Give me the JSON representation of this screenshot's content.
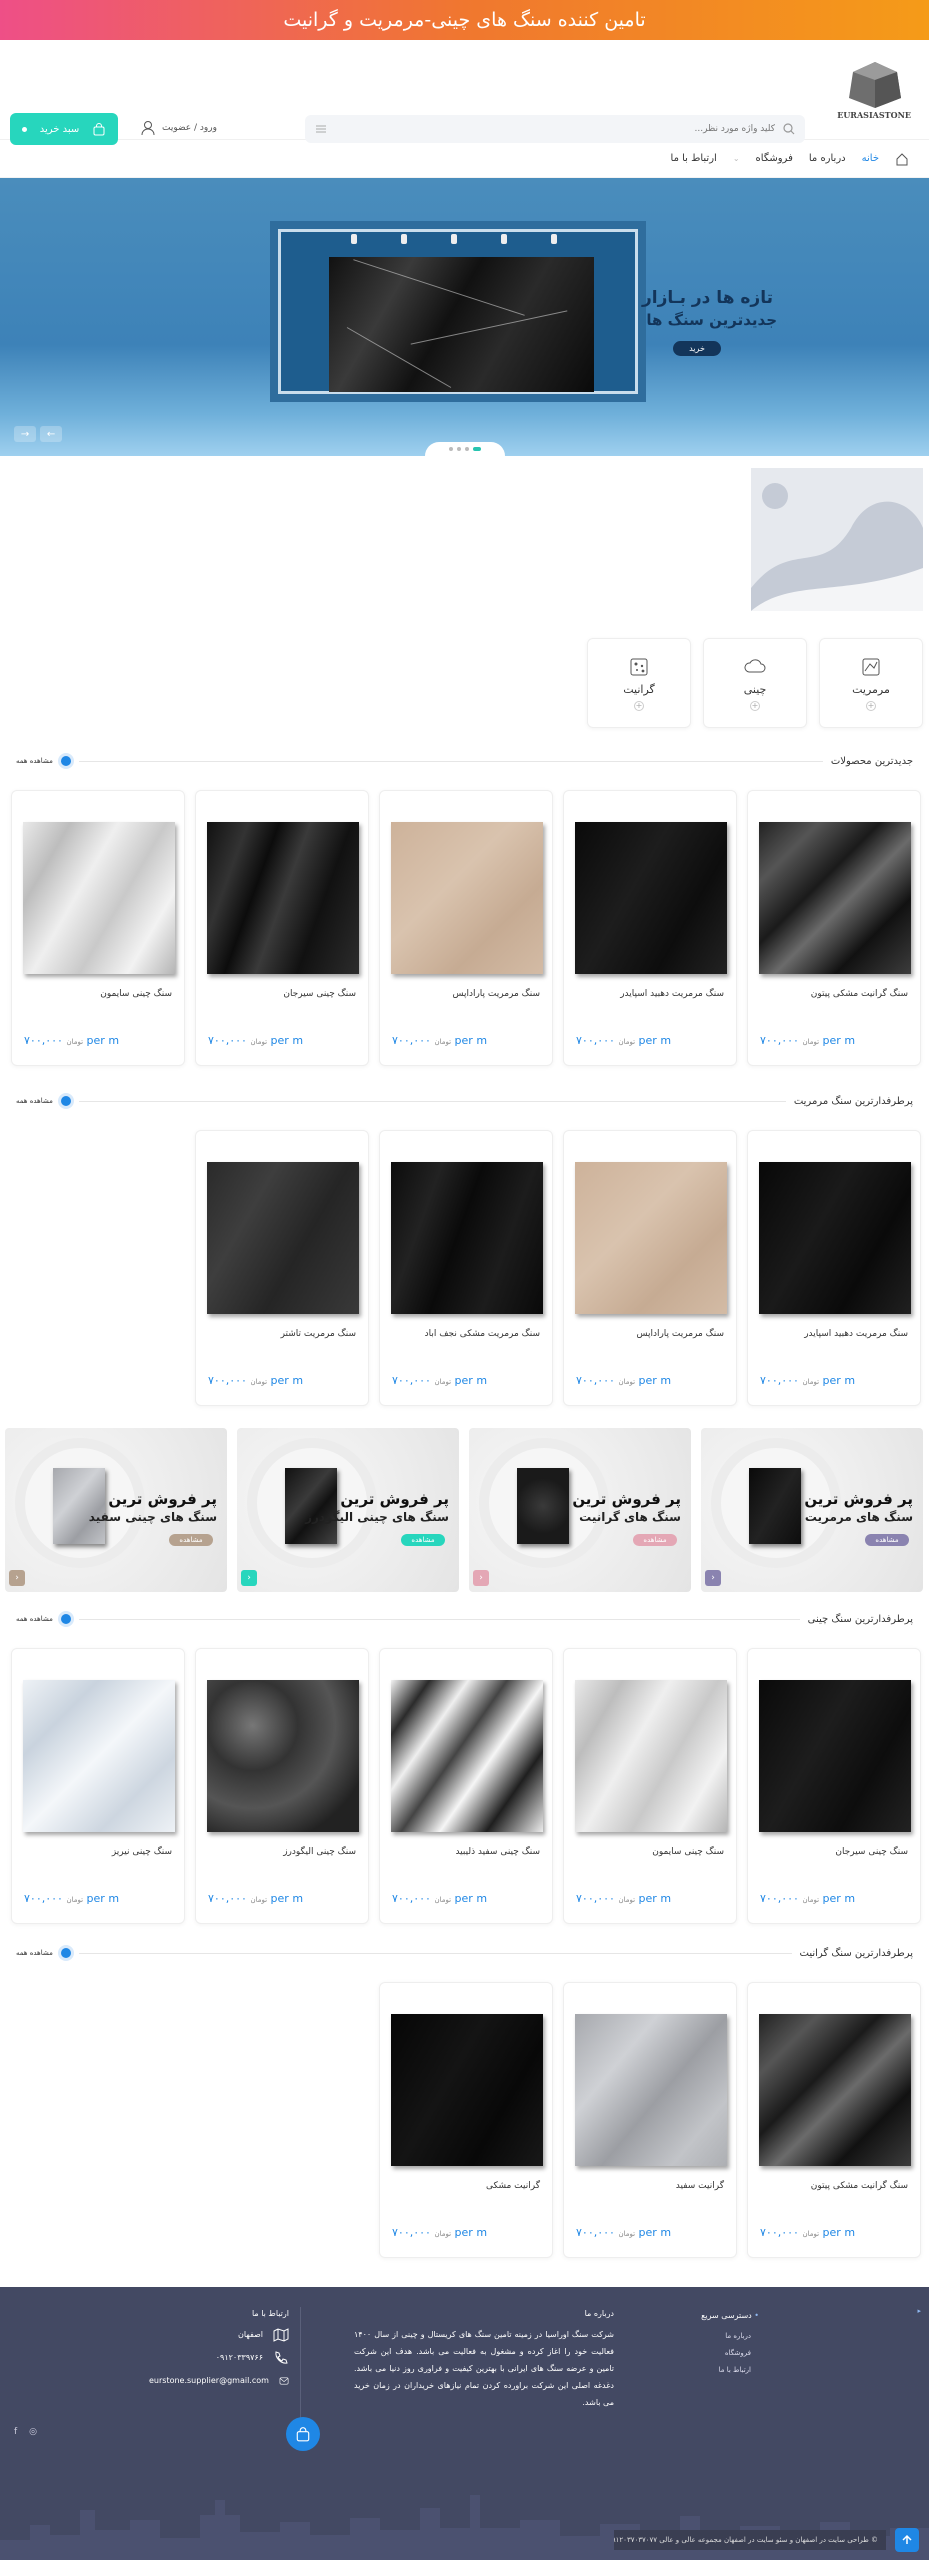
{
  "banner": {
    "text": "تامین کننده سنگ های چینی-مرمریت و گرانیت"
  },
  "header": {
    "logo_text": "EURASIASTONE",
    "search_placeholder": "کلید واژه مورد نظر...",
    "login_label": "ورود / عضویت",
    "cart_label": "سبد خرید",
    "nav": [
      {
        "label": "خانه",
        "active": true
      },
      {
        "label": "درباره ما",
        "active": false
      },
      {
        "label": "فروشگاه",
        "active": false
      },
      {
        "label": "ارتباط با ما",
        "active": false
      }
    ]
  },
  "hero": {
    "title": "تازه ها در بـازار",
    "subtitle": "جدیدترین سنگ ها",
    "button": "خرید",
    "prev_icon": "arrow-left-icon",
    "next_icon": "arrow-right-icon"
  },
  "categories": [
    {
      "label": "مرمریت",
      "icon": "marble-icon"
    },
    {
      "label": "چینی",
      "icon": "cloud-icon"
    },
    {
      "label": "گرانیت",
      "icon": "granite-icon"
    }
  ],
  "sections": {
    "newest": {
      "title": "جدیدترین محصولات",
      "see_all": "مشاهده همه",
      "products": [
        {
          "name": "سنگ گرانیت مشکی پیتون",
          "price": "۷۰۰,۰۰۰",
          "currency": "تومان",
          "unit": "per m"
        },
        {
          "name": "سنگ مرمریت دهبید اسپایدر",
          "price": "۷۰۰,۰۰۰",
          "currency": "تومان",
          "unit": "per m"
        },
        {
          "name": "سنگ مرمریت پاراداپس",
          "price": "۷۰۰,۰۰۰",
          "currency": "تومان",
          "unit": "per m"
        },
        {
          "name": "سنگ چینی سیرجان",
          "price": "۷۰۰,۰۰۰",
          "currency": "تومان",
          "unit": "per m"
        },
        {
          "name": "سنگ چینی سایمون",
          "price": "۷۰۰,۰۰۰",
          "currency": "تومان",
          "unit": "per m"
        }
      ]
    },
    "marble": {
      "title": "پرطرفدارترین سنگ مرمریت",
      "see_all": "مشاهده همه",
      "products": [
        {
          "name": "سنگ مرمریت دهبید اسپایدر",
          "price": "۷۰۰,۰۰۰",
          "currency": "تومان",
          "unit": "per m"
        },
        {
          "name": "سنگ مرمریت پاراداپس",
          "price": "۷۰۰,۰۰۰",
          "currency": "تومان",
          "unit": "per m"
        },
        {
          "name": "سنگ مرمریت مشکی نجف اباد",
          "price": "۷۰۰,۰۰۰",
          "currency": "تومان",
          "unit": "per m"
        },
        {
          "name": "سنگ مرمریت تاشتر",
          "price": "۷۰۰,۰۰۰",
          "currency": "تومان",
          "unit": "per m"
        }
      ]
    },
    "china": {
      "title": "پرطرفدارترین سنگ چینی",
      "see_all": "مشاهده همه",
      "products": [
        {
          "name": "سنگ چینی سیرجان",
          "price": "۷۰۰,۰۰۰",
          "currency": "تومان",
          "unit": "per m"
        },
        {
          "name": "سنگ چینی سایمون",
          "price": "۷۰۰,۰۰۰",
          "currency": "تومان",
          "unit": "per m"
        },
        {
          "name": "سنگ چینی سفید ذلیبید",
          "price": "۷۰۰,۰۰۰",
          "currency": "تومان",
          "unit": "per m"
        },
        {
          "name": "سنگ چینی الیگودرز",
          "price": "۷۰۰,۰۰۰",
          "currency": "تومان",
          "unit": "per m"
        },
        {
          "name": "سنگ چینی نیریز",
          "price": "۷۰۰,۰۰۰",
          "currency": "تومان",
          "unit": "per m"
        }
      ]
    },
    "granite": {
      "title": "پرطرفدارترین سنگ گرانیت",
      "see_all": "مشاهده همه",
      "products": [
        {
          "name": "سنگ گرانیت مشکی پیتون",
          "price": "۷۰۰,۰۰۰",
          "currency": "تومان",
          "unit": "per m"
        },
        {
          "name": "گرانیت سفید",
          "price": "۷۰۰,۰۰۰",
          "currency": "تومان",
          "unit": "per m"
        },
        {
          "name": "گرانیت مشکی",
          "price": "۷۰۰,۰۰۰",
          "currency": "تومان",
          "unit": "per m"
        }
      ]
    }
  },
  "promos": [
    {
      "title": "پر فروش ترین",
      "subtitle": "سنگ های مرمریت",
      "button": "مشاهده",
      "accent": "#8a83b0"
    },
    {
      "title": "پر فروش ترین",
      "subtitle": "سنگ های گرانیت",
      "button": "مشاهده",
      "accent": "#e4a7b5"
    },
    {
      "title": "پر فروش ترین",
      "subtitle": "سنگ های چینی الیگودرز",
      "button": "مشاهده",
      "accent": "#27d6bd"
    },
    {
      "title": "پر فروش ترین",
      "subtitle": "سنگ های چینی سفید",
      "button": "مشاهده",
      "accent": "#b6a28f"
    }
  ],
  "footer": {
    "quick_title": "دسترسی سریع",
    "quick_links": [
      "درباره ما",
      "فروشگاه",
      "ارتباط با ما"
    ],
    "about_title": "درباره ما",
    "about_text": "شرکت سنگ اوراسیا در زمینه تامین سنگ های کریستال و چینی از سال ۱۴۰۰ فعالیت خود را اغاز کرده و مشغول به فعالیت می باشد. هدف این شرکت تامین و عرضه سنگ های ایرانی با بهترین کیفیت و فراوری روز دنیا می باشد. دغدغه اصلی این شرکت براورده کردن تمام نیازهای خریداران در زمان خرید می باشد.",
    "contact_title": "ارتباط با ما",
    "address": "اصفهان",
    "phone": "۰۹۱۲۰۳۳۹۷۶۶",
    "email": "eurstone.supplier@gmail.com",
    "copyright": "© طراحی سایت در اصفهان و سئو سایت در اصفهان مجموعه عالی و عالی ۰۹۱۲۰۳۷۰۳۷۰۷۷",
    "social": [
      "instagram-icon",
      "facebook-icon"
    ]
  },
  "colors": {
    "accent": "#1f87e5",
    "cart": "#27d6bd",
    "footer": "#434963"
  }
}
